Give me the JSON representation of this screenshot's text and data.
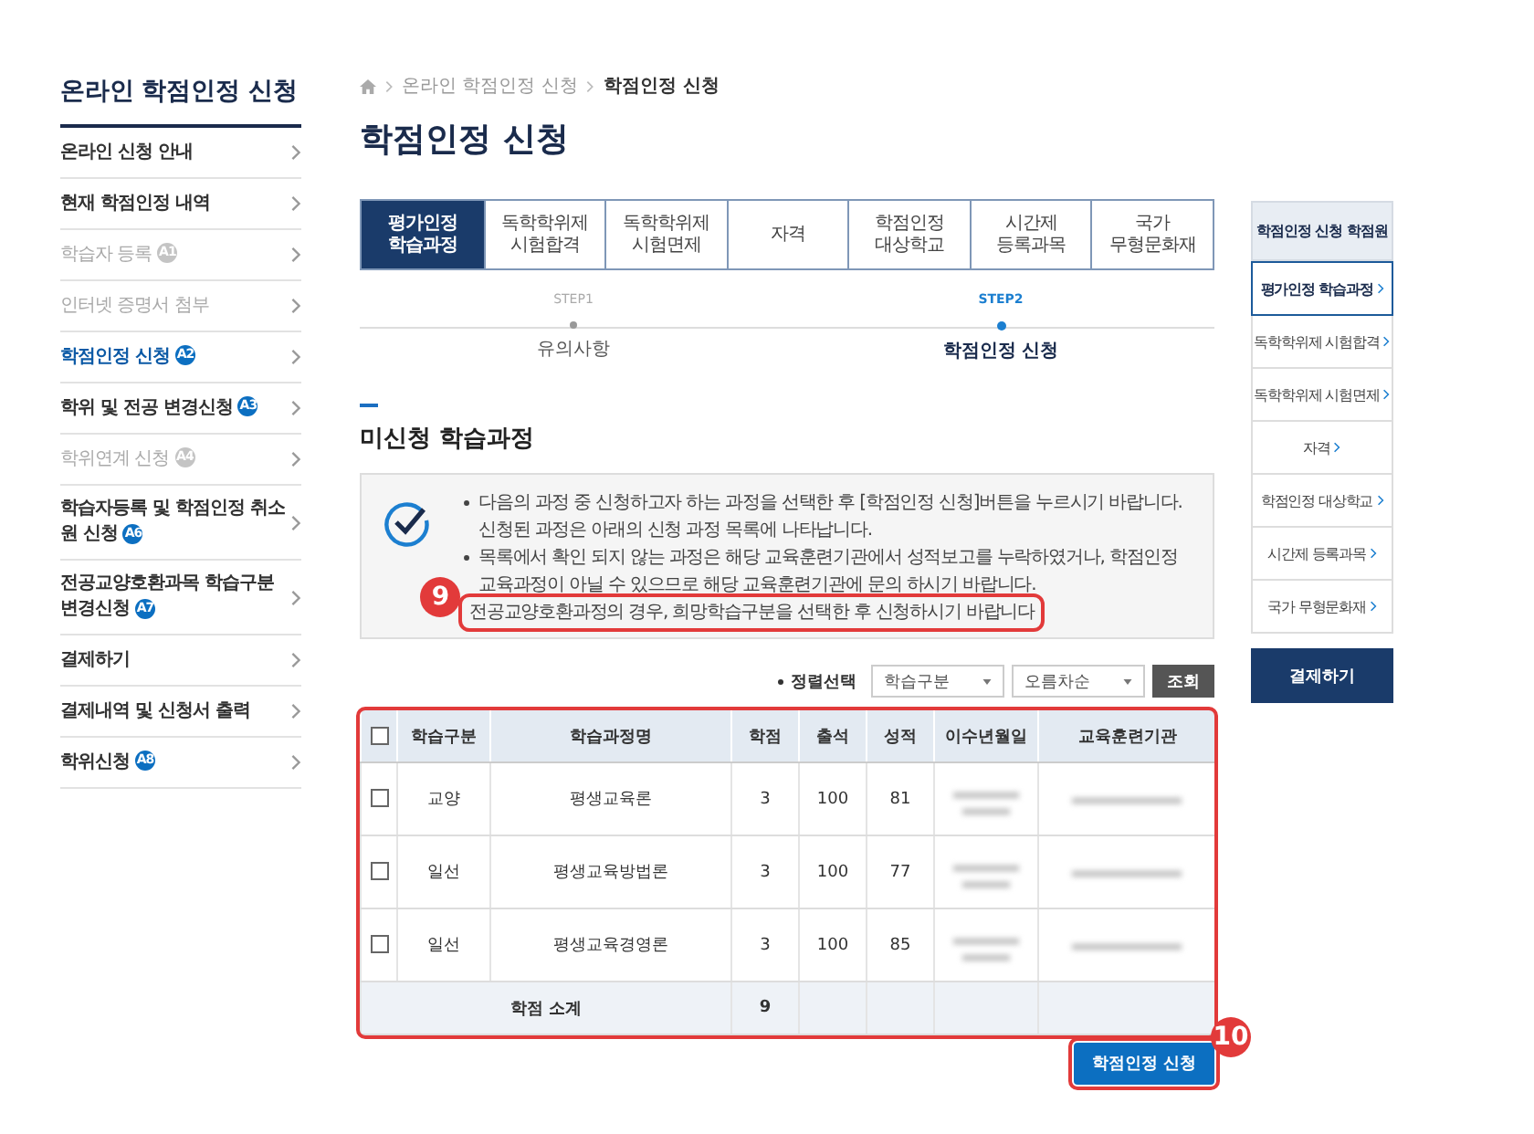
{
  "sidebar": {
    "title": "온라인 학점인정 신청",
    "items": [
      {
        "label": "온라인 신청 안내",
        "selected": false,
        "disabled": false
      },
      {
        "label": "현재 학점인정 내역",
        "selected": false,
        "disabled": false
      },
      {
        "label": "학습자 등록",
        "badge": "A1",
        "selected": false,
        "disabled": true
      },
      {
        "label": "인터넷 증명서 첨부",
        "selected": false,
        "disabled": true
      },
      {
        "label": "학점인정 신청",
        "badge": "A2",
        "selected": true,
        "disabled": false
      },
      {
        "label": "학위 및 전공 변경신청",
        "badge": "A3",
        "selected": false,
        "disabled": false
      },
      {
        "label": "학위연계 신청",
        "badge": "A4",
        "selected": false,
        "disabled": true
      },
      {
        "label": "학습자등록 및 학점인정 취소원 신청",
        "badge": "A6",
        "selected": false,
        "disabled": false
      },
      {
        "label": "전공교양호환과목 학습구분 변경신청",
        "badge": "A7",
        "selected": false,
        "disabled": false
      },
      {
        "label": "결제하기",
        "selected": false,
        "disabled": false
      },
      {
        "label": "결제내역 및 신청서 출력",
        "selected": false,
        "disabled": false
      },
      {
        "label": "학위신청",
        "badge": "A8",
        "selected": false,
        "disabled": false
      }
    ]
  },
  "breadcrumb": [
    "온라인 학점인정 신청",
    "학점인정 신청"
  ],
  "page_title": "학점인정 신청",
  "tabs": [
    {
      "label": "평가인정\n학습과정",
      "selected": true
    },
    {
      "label": "독학학위제\n시험합격",
      "selected": false
    },
    {
      "label": "독학학위제\n시험면제",
      "selected": false
    },
    {
      "label": "자격",
      "selected": false
    },
    {
      "label": "학점인정\n대상학교",
      "selected": false
    },
    {
      "label": "시간제\n등록과목",
      "selected": false
    },
    {
      "label": "국가\n무형문화재",
      "selected": false
    }
  ],
  "steps": [
    {
      "step": "STEP1",
      "label": "유의사항",
      "selected": false
    },
    {
      "step": "STEP2",
      "label": "학점인정 신청",
      "selected": true
    }
  ],
  "section_title": "미신청 학습과정",
  "notice": [
    {
      "kind": "bullet",
      "text": "다음의 과정 중 신청하고자 하는 과정을 선택한 후 [학점인정 신청]버튼을 누르시기 바랍니다. 신청된 과정은 아래의 신청 과정 목록에 나타납니다."
    },
    {
      "kind": "bullet",
      "text": "목록에서 확인 되지 않는 과정은 해당 교육훈련기관에서 성적보고를 누락하였거나, 학점인정 교육과정이 아닐 수 있으므로 해당 교육훈련기관에 문의 하시기 바랍니다."
    },
    {
      "kind": "plain",
      "text": "전공교양호환과정의 경우, 희망학습구분을 선택한 후 신청하시기 바랍니다",
      "callout": "9"
    }
  ],
  "sort": {
    "label": "정렬선택",
    "selects": [
      "학습구분",
      "오름차순"
    ],
    "button": "조회"
  },
  "table": {
    "highlighted": true,
    "all_checked": false,
    "columns": [
      "학습구분",
      "학습과정명",
      "학점",
      "출석",
      "성적",
      "이수년월일",
      "교육훈련기관"
    ],
    "rows": [
      {
        "checked": false,
        "cells": [
          "교양",
          "평생교육론",
          "3",
          "100",
          "81"
        ]
      },
      {
        "checked": false,
        "cells": [
          "일선",
          "평생교육방법론",
          "3",
          "100",
          "77"
        ]
      },
      {
        "checked": false,
        "cells": [
          "일선",
          "평생교육경영론",
          "3",
          "100",
          "85"
        ]
      }
    ],
    "subtotal": {
      "label": "학점 소계",
      "value": "9"
    }
  },
  "submit_button": {
    "label": "학점인정 신청",
    "callout": "10"
  },
  "right_panel": {
    "title": "학점인정 신청 학점원",
    "items": [
      {
        "label": "평가인정 학습과정",
        "selected": true
      },
      {
        "label": "독학학위제 시험합격",
        "selected": false
      },
      {
        "label": "독학학위제 시험면제",
        "selected": false
      },
      {
        "label": "자격",
        "selected": false
      },
      {
        "label": "학점인정 대상학교",
        "selected": false
      },
      {
        "label": "시간제 등록과목",
        "selected": false
      },
      {
        "label": "국가 무형문화재",
        "selected": false
      }
    ],
    "button": "결제하기"
  }
}
